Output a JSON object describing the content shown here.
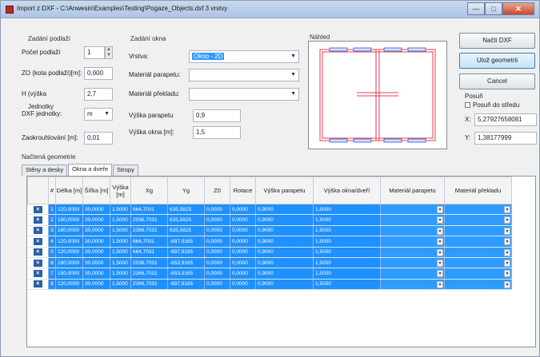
{
  "window": {
    "title": "Import z DXF - C:\\Anwesin\\Examples\\Testing\\Pogaze_Objects.dxf  3 vrstvy",
    "buttons": {
      "minimize": "—",
      "maximize": "□",
      "close": "✕"
    }
  },
  "storey": {
    "group_title": "Zadání podlaží",
    "count_label": "Počet podlaží",
    "count_value": "1",
    "zo_label": "ZO (kota podlaží)[m]:",
    "zo_value": "0,000",
    "height_label": "H (výška",
    "height_value": "2,7",
    "units_label_1": "Jednotky",
    "units_label_2": "DXF jednotky:",
    "units_value": "m",
    "rounding_label": "Zaokrouhlování [m]:",
    "rounding_value": "0,01"
  },
  "window_settings": {
    "group_title": "Zadání okna",
    "layer_label": "Vrstva:",
    "layer_value": "Okno - 2D",
    "parapet_material_label": "Materiál parapetu:",
    "parapet_material_value": "",
    "lintel_material_label": "Materiál překladu:",
    "lintel_material_value": "",
    "parapet_height_label": "Výška parapetu",
    "parapet_height_value": "0,9",
    "window_height_label": "Výška okna [m]:",
    "window_height_value": "1,5"
  },
  "preview": {
    "title": "Náhled"
  },
  "actions": {
    "load_dxf": "Načti DXF",
    "load_geometry": "Ulož geometrii",
    "cancel": "Cancel"
  },
  "shift": {
    "title": "Posuň",
    "checkbox_label": "Posuň do středu",
    "x_label": "X:",
    "x_value": "5,27927658081",
    "y_label": "Y:",
    "y_value": "1,38177999"
  },
  "geometry": {
    "group_title": "Načtená geometrie",
    "tabs": [
      "Stěny a desky",
      "Okna a dveře",
      "Stropy"
    ],
    "active_tab": "Okna a dveře"
  },
  "table": {
    "columns": [
      "",
      "#",
      "Délka [m]",
      "Šířka [m]",
      "Výška [m]",
      "Xg",
      "Yg",
      "Z0",
      "Rotace",
      "Výška parapetu",
      "Výška okna/dveří",
      "Materiál parapetu",
      "Materiál překladu"
    ],
    "rows": [
      [
        "1",
        "120,0000",
        "30,0000",
        "1,5000",
        "664,7031",
        "635,5825",
        "0,0000",
        "0,0000",
        "0,9000",
        "1,5000",
        "",
        ""
      ],
      [
        "2",
        "180,0000",
        "30,0000",
        "1,5000",
        "2036,7031",
        "635,5825",
        "0,0000",
        "0,0000",
        "0,9000",
        "1,5000",
        "",
        ""
      ],
      [
        "3",
        "180,0000",
        "30,0000",
        "1,5000",
        "2366,7031",
        "635,5825",
        "0,0000",
        "0,0000",
        "0,9000",
        "1,5000",
        "",
        ""
      ],
      [
        "4",
        "120,0000",
        "30,0000",
        "1,5000",
        "664,7031",
        "-697,9165",
        "0,0000",
        "0,0000",
        "0,9000",
        "1,5000",
        "",
        ""
      ],
      [
        "5",
        "120,0000",
        "30,0000",
        "1,5000",
        "664,7031",
        "-697,9165",
        "0,0000",
        "0,0000",
        "0,9000",
        "1,5000",
        "",
        ""
      ],
      [
        "6",
        "180,0000",
        "30,0000",
        "1,5000",
        "2036,7031",
        "-653,9165",
        "0,0000",
        "0,0000",
        "0,9000",
        "1,5000",
        "",
        ""
      ],
      [
        "7",
        "180,0000",
        "30,0000",
        "1,5000",
        "2366,7031",
        "-653,9165",
        "0,0000",
        "0,0000",
        "0,9000",
        "1,5000",
        "",
        ""
      ],
      [
        "8",
        "120,0000",
        "30,0000",
        "1,5000",
        "2366,7031",
        "-697,9165",
        "0,0000",
        "0,0000",
        "0,9000",
        "1,5000",
        "",
        ""
      ]
    ]
  },
  "colors": {
    "selection": "#1e90ff",
    "preview_lines": "#e83c55"
  },
  "icons": {
    "row": "delete-row-icon",
    "dropdown": "chevron-down-icon"
  }
}
